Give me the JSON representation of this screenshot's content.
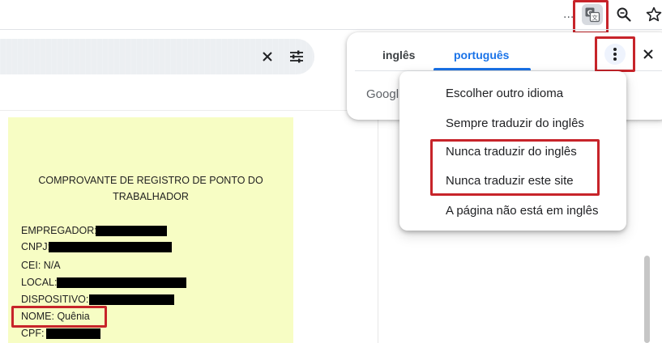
{
  "toolbar": {
    "omnibox_ellipsis": "...",
    "icons": [
      "translate-icon",
      "zoom-icon",
      "star-icon"
    ]
  },
  "findbar": {
    "icons": [
      "close-icon",
      "tune-icon"
    ]
  },
  "translate_popup": {
    "tabs": [
      {
        "label": "inglês",
        "active": false
      },
      {
        "label": "português",
        "active": true
      }
    ],
    "google_text": "Googl",
    "accent_color": "#1a73e8"
  },
  "menu": {
    "items": [
      {
        "label": "Escolher outro idioma"
      },
      {
        "label": "Sempre traduzir do inglês"
      },
      {
        "label": "Nunca traduzir do inglês"
      },
      {
        "label": "Nunca traduzir este site"
      },
      {
        "label": "A página não está em inglês"
      }
    ]
  },
  "receipt": {
    "title_line1": "COMPROVANTE DE REGISTRO DE PONTO DO",
    "title_line2": "TRABALHADOR",
    "fields": [
      {
        "label": "EMPREGADOR:",
        "value": ""
      },
      {
        "label": "CNPJ:",
        "value": ""
      },
      {
        "label": "CEI: N/A",
        "value": ""
      },
      {
        "label": "LOCAL:",
        "value": ""
      },
      {
        "label": "DISPOSITIVO:",
        "value": ""
      },
      {
        "label": "NOME: Quênia",
        "value": ""
      },
      {
        "label": "CPF:",
        "value": ""
      }
    ],
    "background_color": "#f7fdc4"
  },
  "highlight_color": "#c7242a"
}
